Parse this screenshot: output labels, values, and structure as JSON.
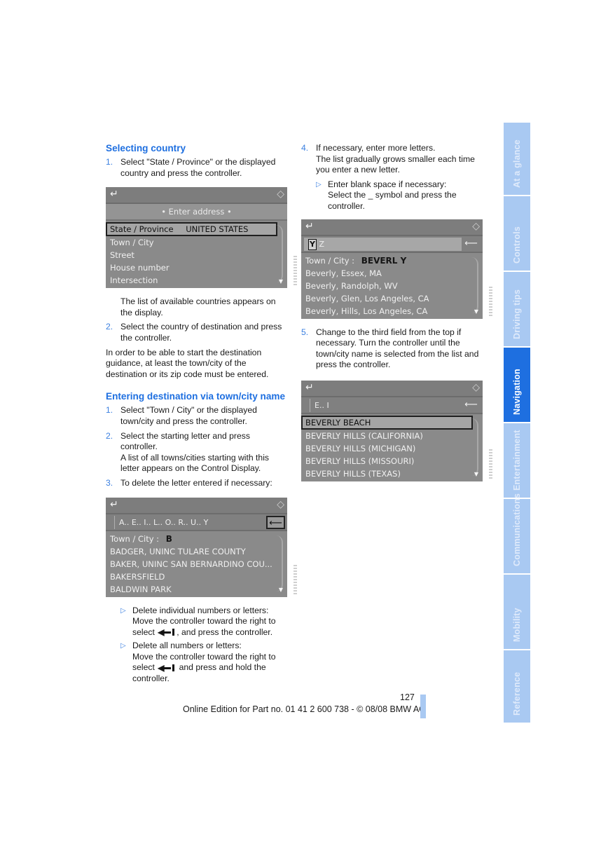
{
  "left_column": {
    "section1": {
      "title": "Selecting country",
      "step1_num": "1.",
      "step1": "Select \"State / Province\" or the displayed country and press the controller.",
      "screen": {
        "header": "• Enter address •",
        "rows": [
          "Town / City",
          "Street",
          "House number",
          "Intersection"
        ],
        "selected_label": "State / Province",
        "selected_value": "UNITED STATES"
      },
      "after_screen": "The list of available countries appears on the display.",
      "step2_num": "2.",
      "step2": "Select the country of destination and press the controller.",
      "note": "In order to be able to start the destination guidance, at least the town/city of the destination or its zip code must be entered."
    },
    "section2": {
      "title": "Entering destination via town/city name",
      "step1_num": "1.",
      "step1": "Select \"Town / City\" or the displayed town/city and press the controller.",
      "step2_num": "2.",
      "step2a": "Select the starting letter and press controller.",
      "step2b": "A list of all towns/cities starting with this letter appears on the Control Display.",
      "step3_num": "3.",
      "step3": "To delete the letter entered if necessary:",
      "screen": {
        "input": "A.. E.. I.. L.. O.. R.. U.. Y",
        "town_label": "Town / City :",
        "town_value": "B",
        "rows": [
          "BADGER, UNINC TULARE COUNTY",
          "BAKER, UNINC SAN BERNARDINO COU...",
          "BAKERSFIELD",
          "BALDWIN PARK"
        ]
      },
      "bullet1_title": "Delete individual numbers or letters:",
      "bullet1_a": "Move the controller toward the right to select",
      "bullet1_b": ", and press the controller.",
      "bullet2_title": "Delete all numbers or letters:",
      "bullet2_a": "Move the controller toward the right to select",
      "bullet2_b": "and press and hold the controller."
    }
  },
  "right_column": {
    "step4_num": "4.",
    "step4a": "If necessary, enter more letters.",
    "step4b": "The list gradually grows smaller each time you enter a new letter.",
    "bullet_title": "Enter blank space if necessary:",
    "bullet_text": "Select the _ symbol and press the controller.",
    "screen1": {
      "cursor_letter": "Y",
      "input_rest": "Z",
      "town_label": "Town / City :",
      "town_value": "BEVERL Y",
      "rows": [
        "Beverly, Essex, MA",
        "Beverly, Randolph, WV",
        "Beverly, Glen, Los Angeles, CA",
        "Beverly, Hills, Los Angeles, CA"
      ]
    },
    "step5_num": "5.",
    "step5": "Change to the third field from the top if necessary. Turn the controller until the town/city name is selected from the list and press the controller.",
    "screen2": {
      "input": "E.. I",
      "selected": "BEVERLY BEACH",
      "rows": [
        "BEVERLY HILLS (CALIFORNIA)",
        "BEVERLY HILLS (MICHIGAN)",
        "BEVERLY HILLS (MISSOURI)",
        "BEVERLY HILLS (TEXAS)"
      ]
    }
  },
  "icons": {
    "back": "↵",
    "controller": "◇",
    "delete": "⟵",
    "scroll_down": "▼",
    "bullet": "▷"
  },
  "side_tabs": [
    {
      "label": "At a glance",
      "active": false
    },
    {
      "label": "Controls",
      "active": false
    },
    {
      "label": "Driving tips",
      "active": false
    },
    {
      "label": "Navigation",
      "active": true
    },
    {
      "label": "Entertainment",
      "active": false
    },
    {
      "label": "Communications",
      "active": false
    },
    {
      "label": "Mobility",
      "active": false
    },
    {
      "label": "Reference",
      "active": false
    }
  ],
  "footer": {
    "page_number": "127",
    "edition": "Online Edition for Part no. 01 41 2 600 738 - © 08/08 BMW AG"
  },
  "colors": {
    "accent": "#1e6fe0",
    "tab_inactive": "#a9c9f2",
    "screen_gray": "#8a8a8a"
  }
}
